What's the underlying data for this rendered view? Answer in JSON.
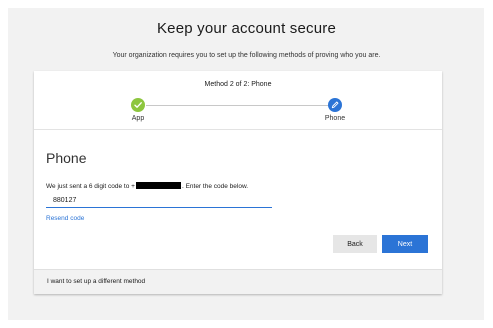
{
  "page": {
    "title": "Keep your account secure",
    "subtitle": "Your organization requires you to set up the following methods of proving who you are."
  },
  "stepper": {
    "caption": "Method 2 of 2: Phone",
    "steps": [
      {
        "label": "App",
        "status": "completed",
        "icon": "checkmark-icon",
        "color": "#8dc63f"
      },
      {
        "label": "Phone",
        "status": "current",
        "icon": "pencil-icon",
        "color": "#2b74d6"
      }
    ]
  },
  "method": {
    "title": "Phone",
    "instruction_prefix": "We just sent a 6 digit code to +",
    "instruction_suffix": ". Enter the code below.",
    "code_value": "880127",
    "resend_label": "Resend code"
  },
  "buttons": {
    "back_label": "Back",
    "next_label": "Next"
  },
  "footer": {
    "different_method_label": "I want to set up a different method"
  },
  "colors": {
    "accent": "#2b74d6",
    "success": "#8dc63f",
    "background": "#f2f2f2"
  }
}
